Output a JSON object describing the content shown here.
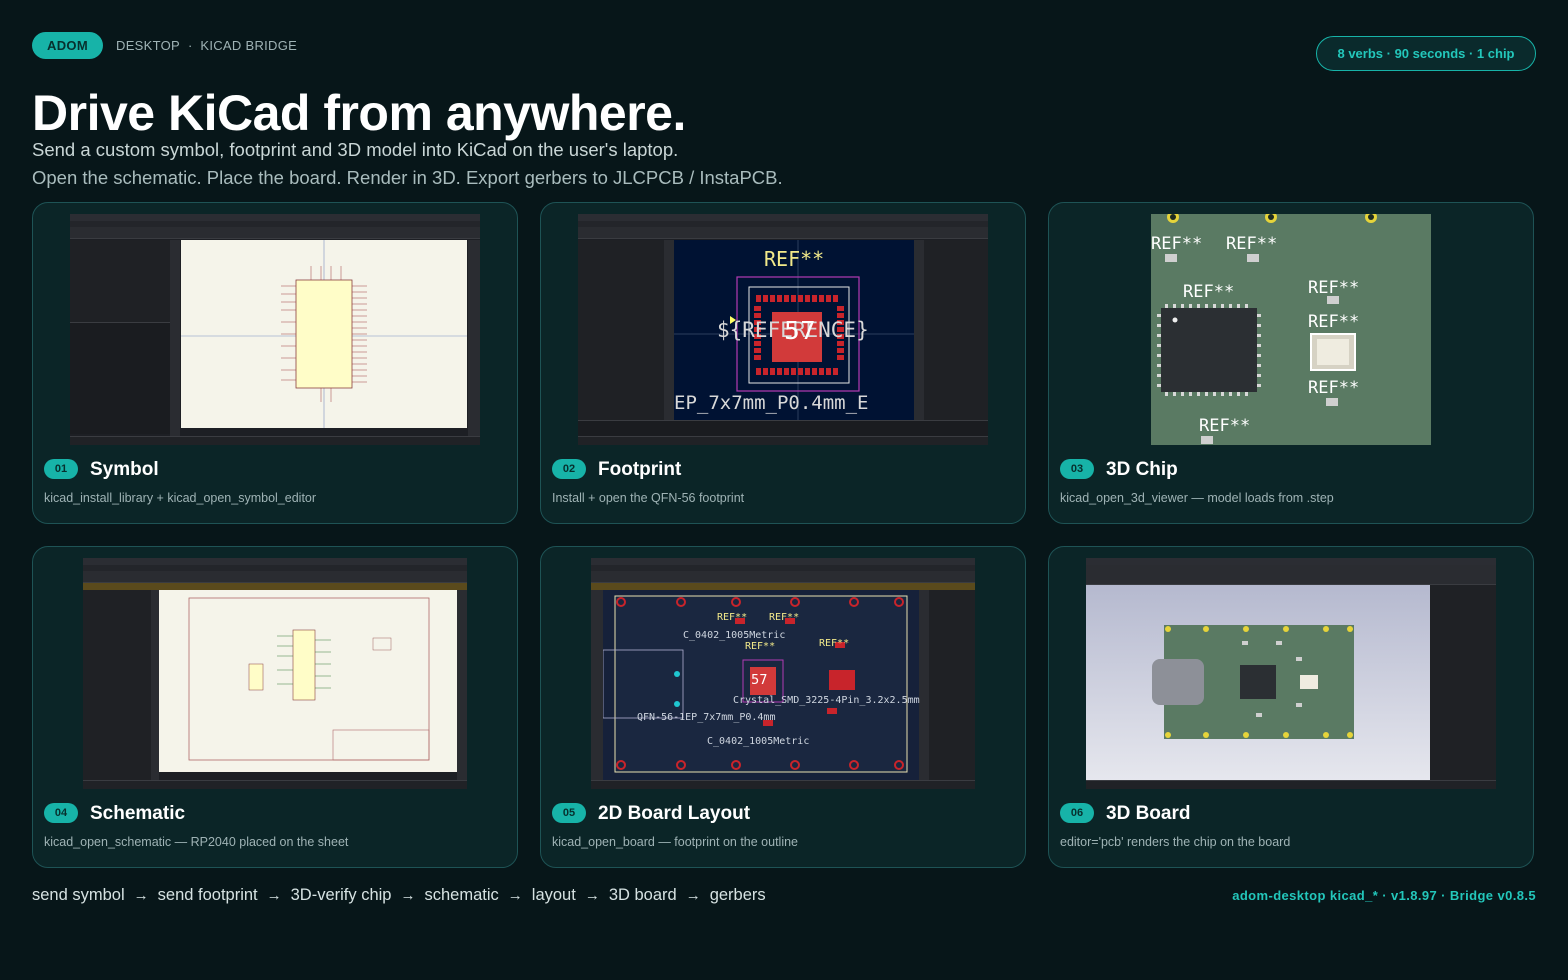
{
  "header": {
    "brand": "ADOM",
    "crumb_1": "DESKTOP",
    "crumb_sep": "·",
    "crumb_2": "KICAD BRIDGE",
    "stats": "8 verbs · 90 seconds · 1 chip",
    "headline": "Drive KiCad from anywhere.",
    "subline_1": "Send a custom symbol, footprint and 3D model into KiCad on the user's laptop.",
    "subline_2": "Open the schematic. Place the board. Render in 3D. Export gerbers to JLCPCB / InstaPCB."
  },
  "cards": [
    {
      "num": "01",
      "title": "Symbol",
      "desc": "kicad_install_library + kicad_open_symbol_editor"
    },
    {
      "num": "02",
      "title": "Footprint",
      "desc": "Install + open the QFN-56 footprint"
    },
    {
      "num": "03",
      "title": "3D Chip",
      "desc": "kicad_open_3d_viewer — model loads from .step"
    },
    {
      "num": "04",
      "title": "Schematic",
      "desc": "kicad_open_schematic — RP2040 placed on the sheet"
    },
    {
      "num": "05",
      "title": "2D Board Layout",
      "desc": "kicad_open_board — footprint on the outline"
    },
    {
      "num": "06",
      "title": "3D Board",
      "desc": "editor='pcb' renders the chip on the board"
    }
  ],
  "screens": {
    "footprint_ref": "REF**",
    "footprint_value": "${REFERENCE}",
    "footprint_badge": "57",
    "footprint_name": "EP_7x7mm_P0.4mm_E",
    "chip_ref": "REF**",
    "layout_ref": "REF**",
    "layout_label_1": "C_0402_1005Metric",
    "layout_label_2": "QFN-56-1EP_7x7mm_P0.4mm",
    "layout_label_3": "Crystal_SMD_3225-4Pin_3.2x2.5mm",
    "layout_badge": "57"
  },
  "flow": {
    "steps": [
      "send symbol",
      "send footprint",
      "3D-verify chip",
      "schematic",
      "layout",
      "3D board",
      "gerbers"
    ],
    "arrow": "→"
  },
  "footer": {
    "version": "adom-desktop kicad_* · v1.8.97 · Bridge v0.8.5"
  },
  "colors": {
    "background": "#071619",
    "accent": "#17b3a8",
    "card_bg": "#0b2527",
    "card_border": "#1e5355",
    "pcb_green": "#5a7a63",
    "pcb_dark": "#16213a",
    "badge_red": "#d23a3a"
  }
}
